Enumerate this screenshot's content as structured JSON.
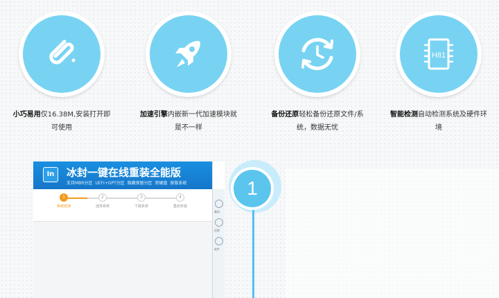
{
  "features": [
    {
      "title": "小巧易用",
      "desc": "仅16.38M,安装打开即可使用",
      "icon": "paperclip-icon"
    },
    {
      "title": "加速引擎",
      "desc": "内嵌新一代加速模块就是不一样",
      "icon": "rocket-icon"
    },
    {
      "title": "备份还原",
      "desc": "轻松备份还原文件/系统，数据无忧",
      "icon": "restore-clock-icon"
    },
    {
      "title": "智能检测",
      "desc": "自动检测系统及硬件环境",
      "icon": "chip-icon",
      "chip_label": "H81"
    }
  ],
  "app": {
    "logo": "In",
    "title": "冰封一键在线重装全能版",
    "subtitle": "支持MBR分区 UEFI+GPT分区 隐藏保留分区 双硬盘 原版系统",
    "steps": [
      {
        "num": "1",
        "label": "系统检测"
      },
      {
        "num": "2",
        "label": "选择系统"
      },
      {
        "num": "3",
        "label": "下载系统"
      },
      {
        "num": "4",
        "label": "重启安装"
      }
    ],
    "side_items": [
      "一键",
      "备份",
      "还原",
      "软件"
    ]
  },
  "timeline": {
    "step": "1"
  },
  "colors": {
    "icon_bg": "#78d3f2",
    "accent": "#f39a1e",
    "app_blue": "#1a8fe0",
    "timeline": "#52c1ef"
  }
}
